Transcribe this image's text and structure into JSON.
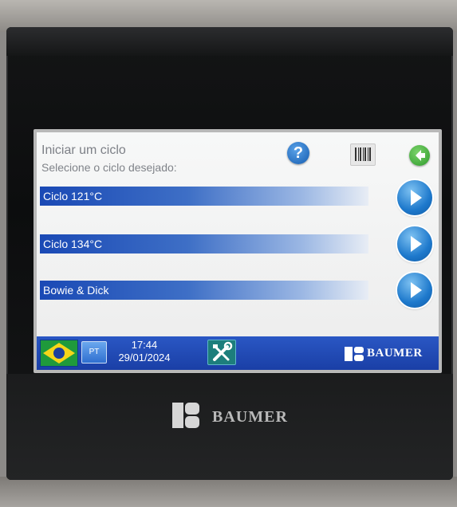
{
  "header": {
    "title": "Iniciar um ciclo",
    "subtitle": "Selecione o ciclo desejado:",
    "help_label": "?",
    "help_icon": "help-icon",
    "barcode_icon": "barcode-icon",
    "back_icon": "arrow-left-icon"
  },
  "cycles": [
    {
      "label": "Ciclo 121°C",
      "action_icon": "play-icon"
    },
    {
      "label": "Ciclo 134°C",
      "action_icon": "play-icon"
    },
    {
      "label": "Bowie & Dick",
      "action_icon": "play-icon"
    }
  ],
  "status_bar": {
    "flag_icon": "brazil-flag-icon",
    "language": "PT",
    "time": "17:44",
    "date": "29/01/2024",
    "tools_icon": "tools-icon",
    "brand": "BAUMER"
  },
  "bezel": {
    "brand": "BAUMER"
  },
  "colors": {
    "bar_blue": "#1a49b5",
    "status_bar_blue": "#1a3fa6",
    "back_green": "#2f9a2c",
    "play_blue": "#1e79cc"
  }
}
